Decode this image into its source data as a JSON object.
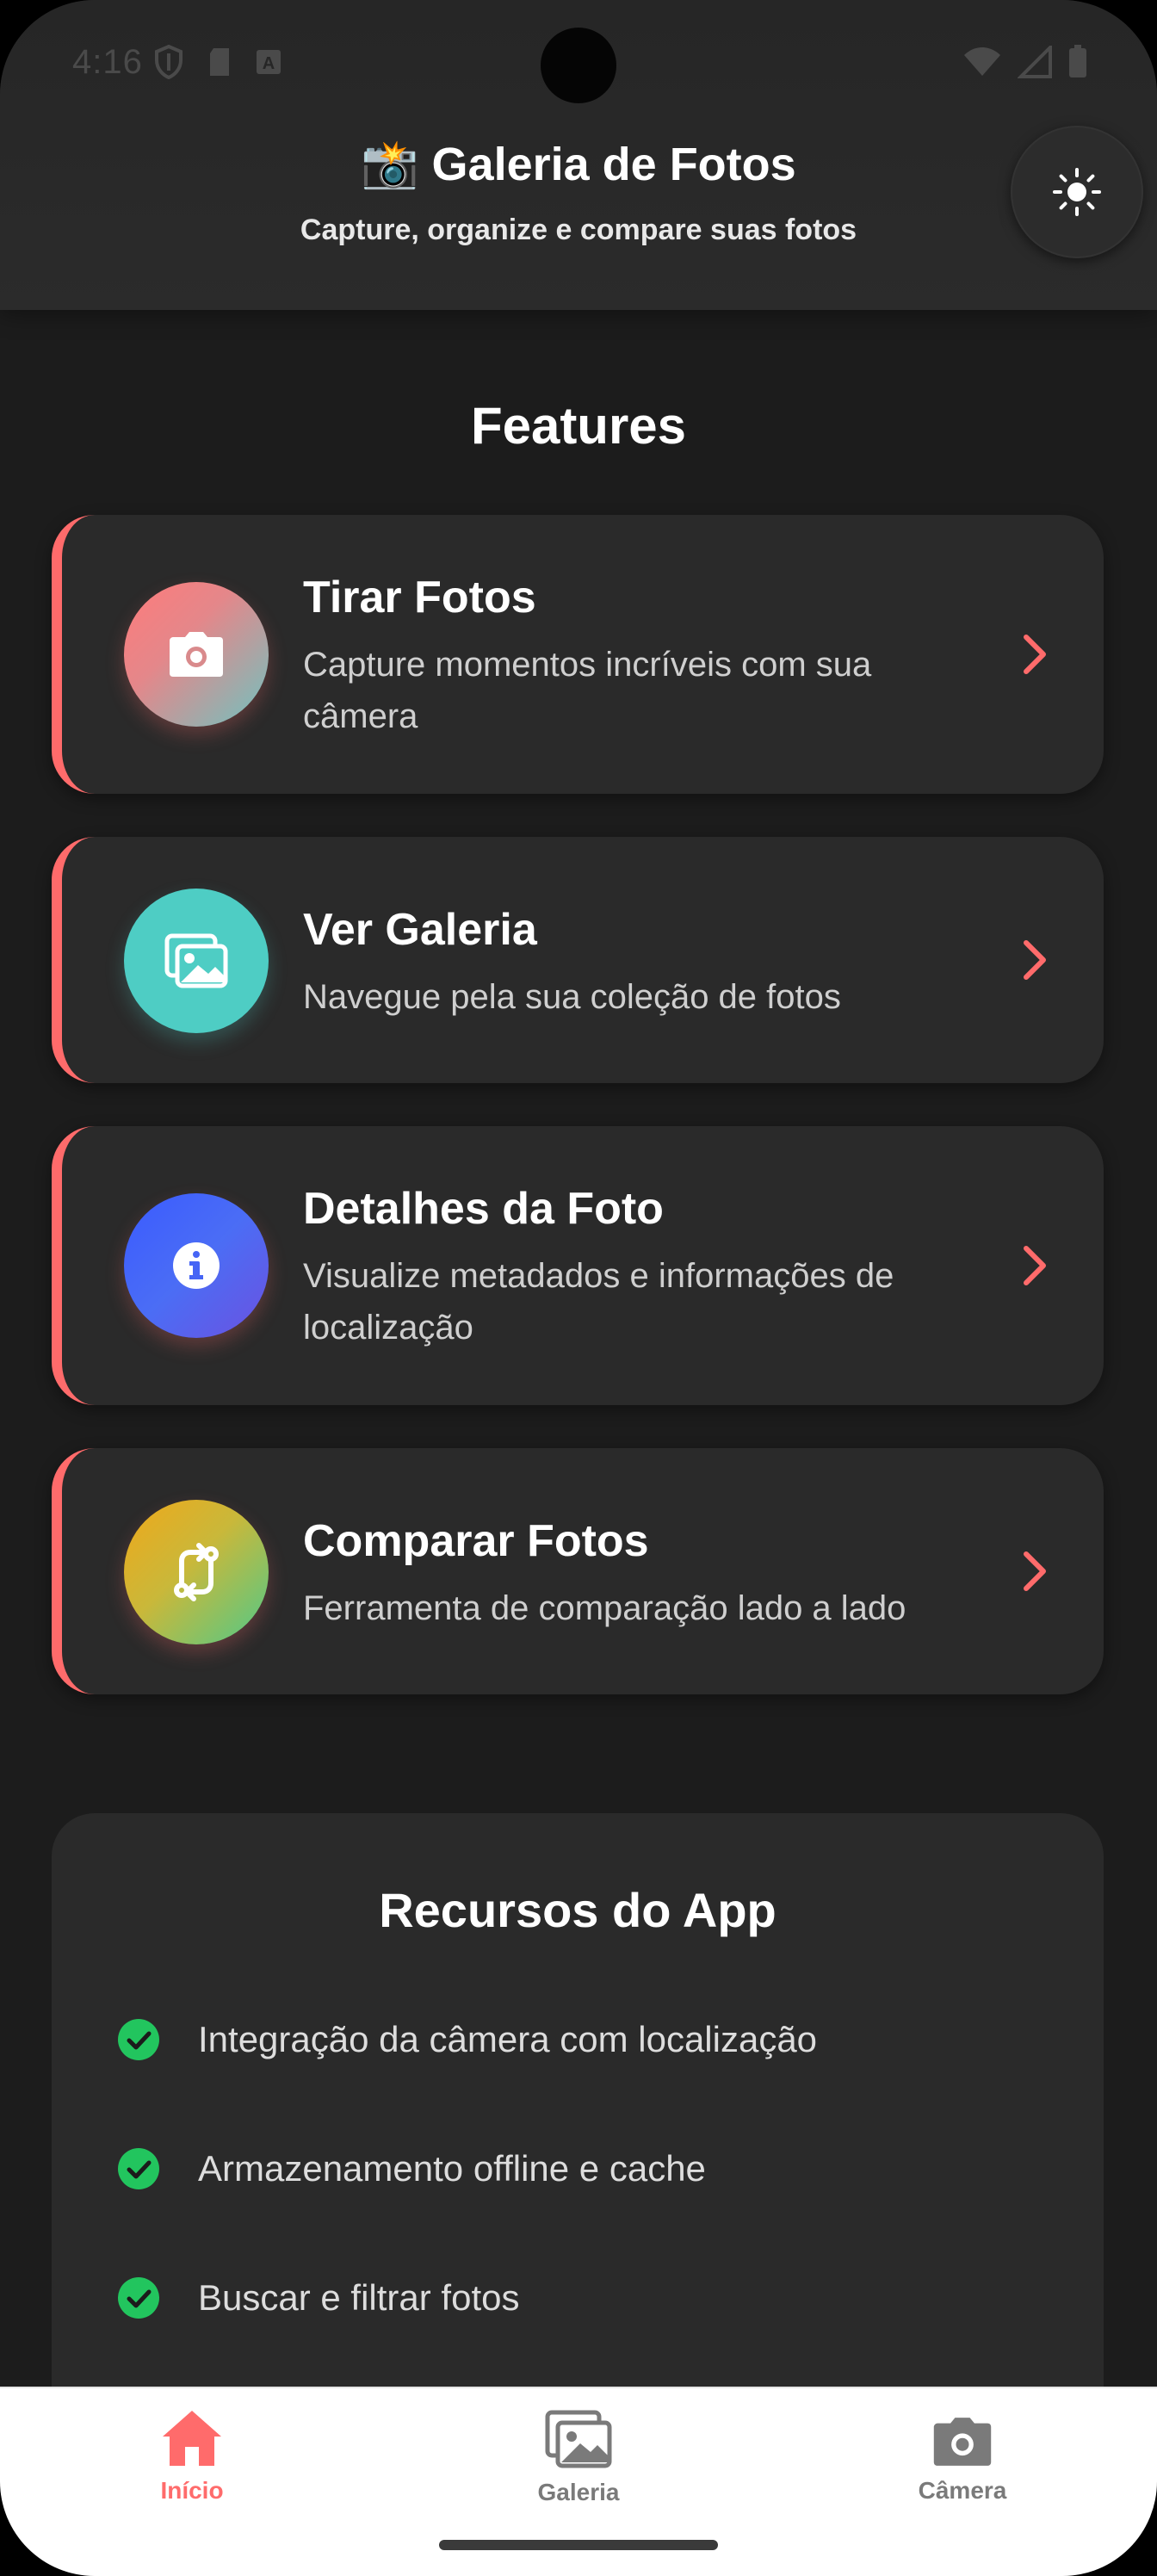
{
  "status_bar": {
    "time": "4:16"
  },
  "header": {
    "title": "📸 Galeria de Fotos",
    "subtitle": "Capture, organize e compare suas fotos",
    "theme_toggle_icon": "sun-icon"
  },
  "features": {
    "title": "Features",
    "accent_color": "#ff6b6b",
    "items": [
      {
        "title": "Tirar Fotos",
        "description": "Capture momentos incríveis com sua câmera",
        "icon": "camera-icon"
      },
      {
        "title": "Ver Galeria",
        "description": "Navegue pela sua coleção de fotos",
        "icon": "gallery-icon"
      },
      {
        "title": "Detalhes da Foto",
        "description": "Visualize metadados e informações de localização",
        "icon": "info-icon"
      },
      {
        "title": "Comparar Fotos",
        "description": "Ferramenta de comparação lado a lado",
        "icon": "compare-icon"
      }
    ]
  },
  "resources": {
    "title": "Recursos do App",
    "check_color": "#22c55e",
    "items": [
      {
        "text": "Integração da câmera com localização"
      },
      {
        "text": "Armazenamento offline e cache"
      },
      {
        "text": "Buscar e filtrar fotos"
      }
    ]
  },
  "bottom_nav": {
    "active_color": "#ff6b6b",
    "inactive_color": "#7a7a7a",
    "items": [
      {
        "label": "Início",
        "icon": "home-icon",
        "active": true
      },
      {
        "label": "Galeria",
        "icon": "gallery-icon",
        "active": false
      },
      {
        "label": "Câmera",
        "icon": "camera-icon",
        "active": false
      }
    ]
  }
}
